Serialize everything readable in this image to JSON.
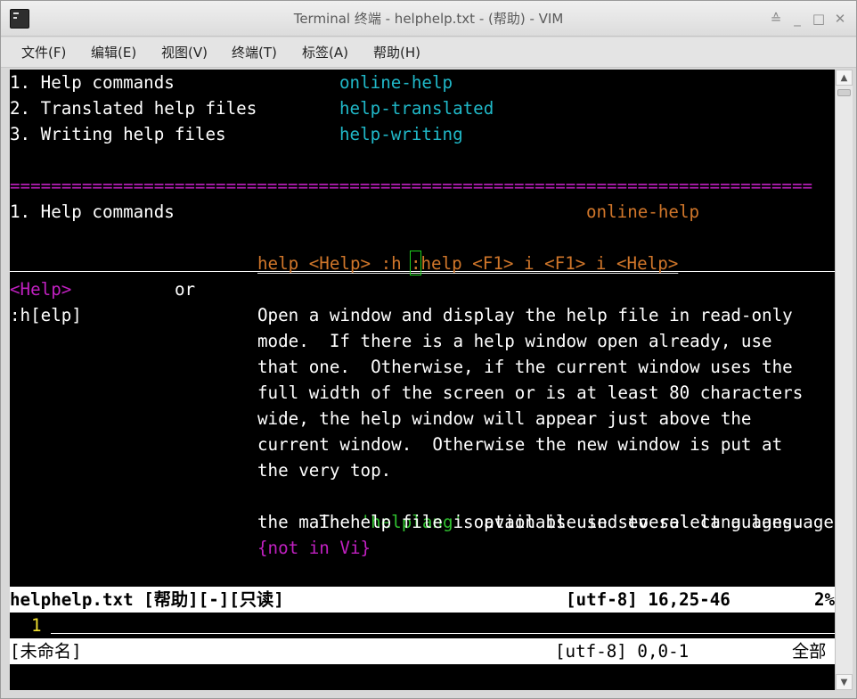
{
  "window": {
    "title": "Terminal 终端 - helphelp.txt - (帮助) - VIM",
    "buttons": {
      "shade": "≙",
      "minimize": "_",
      "maximize": "□",
      "close": "✕"
    }
  },
  "menubar": {
    "items": [
      "文件(F)",
      "编辑(E)",
      "视图(V)",
      "终端(T)",
      "标签(A)",
      "帮助(H)"
    ]
  },
  "vim": {
    "toc": [
      {
        "label": "1. Help commands",
        "tag": "online-help"
      },
      {
        "label": "2. Translated help files",
        "tag": "help-translated"
      },
      {
        "label": "3. Writing help files",
        "tag": "help-writing"
      }
    ],
    "separator": "==============================================================================",
    "section_heading": {
      "label": "1. Help commands",
      "tag": "online-help"
    },
    "tag_line": {
      "before_cursor": "help <Help> :h ",
      "cursor_char": ":",
      "after_cursor": "help <F1> i <F1> i <Help>"
    },
    "help_key": "<Help>",
    "or_word": "or",
    "command": ":h[elp]",
    "description": [
      "Open a window and display the help file in read-only",
      "mode.  If there is a help window open already, use",
      "that one.  Otherwise, if the current window uses the",
      "full width of the screen or is at least 80 characters",
      "wide, the help window will appear just above the",
      "current window.  Otherwise the new window is put at",
      "the very top."
    ],
    "helplang_line": {
      "before": "The ",
      "option": "'helplang'",
      "after": " option is used to select a language, if"
    },
    "last_line": "the main help file is available in several languages.",
    "not_in_vi": "{not in Vi}",
    "status_top": {
      "file": "helphelp.txt [帮助][-][只读]",
      "position": "[utf-8] 16,25-46",
      "percent": "2%"
    },
    "second_window_line_number": "1",
    "status_bottom": {
      "file": "[未命名]",
      "position": "[utf-8] 0,0-1",
      "percent": "全部"
    }
  }
}
